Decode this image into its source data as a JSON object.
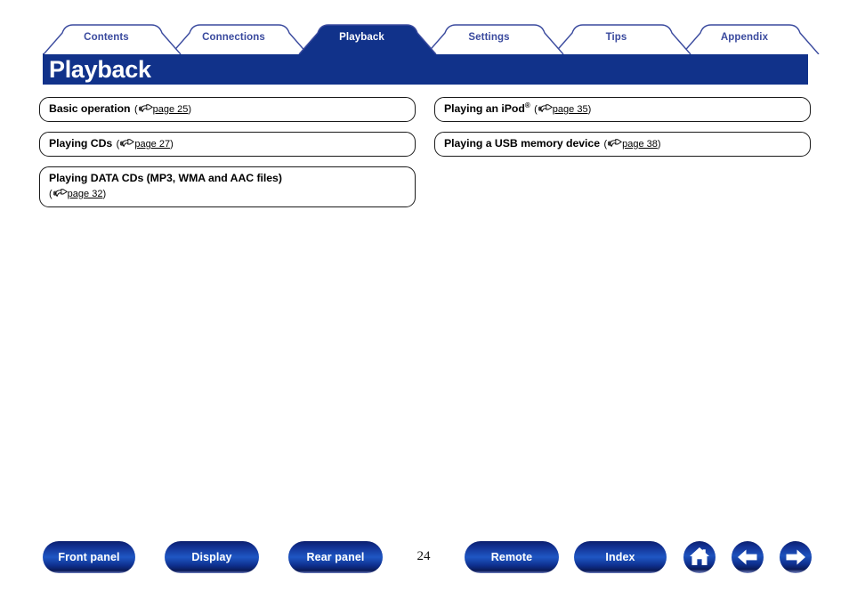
{
  "document": {
    "page_number": "24",
    "page_title": "Playback"
  },
  "tabs": [
    {
      "label": "Contents",
      "active": false
    },
    {
      "label": "Connections",
      "active": false
    },
    {
      "label": "Playback",
      "active": true
    },
    {
      "label": "Settings",
      "active": false
    },
    {
      "label": "Tips",
      "active": false
    },
    {
      "label": "Appendix",
      "active": false
    }
  ],
  "links": {
    "left": [
      {
        "title": "Basic operation",
        "ref_open": "(",
        "ref_icon": "pointing-hand-icon",
        "ref_page": "page 25",
        "ref_close": ")",
        "two_line": false
      },
      {
        "title": "Playing CDs",
        "ref_open": "(",
        "ref_icon": "pointing-hand-icon",
        "ref_page": "page 27",
        "ref_close": ")",
        "two_line": false
      },
      {
        "title": "Playing DATA CDs (MP3, WMA and AAC files)",
        "ref_open": "(",
        "ref_icon": "pointing-hand-icon",
        "ref_page": "page 32",
        "ref_close": ")",
        "two_line": true
      }
    ],
    "right": [
      {
        "title": "Playing an iPod",
        "title_sup": "®",
        "ref_open": "(",
        "ref_icon": "pointing-hand-icon",
        "ref_page": "page 35",
        "ref_close": ")",
        "two_line": false
      },
      {
        "title": "Playing a USB memory device",
        "ref_open": "(",
        "ref_icon": "pointing-hand-icon",
        "ref_page": "page 38",
        "ref_close": ")",
        "two_line": false
      }
    ]
  },
  "footer": {
    "buttons": [
      {
        "label": "Front panel"
      },
      {
        "label": "Display"
      },
      {
        "label": "Rear panel"
      },
      {
        "label": "Remote"
      },
      {
        "label": "Index"
      }
    ],
    "icons": [
      {
        "name": "home-icon"
      },
      {
        "name": "arrow-left-icon"
      },
      {
        "name": "arrow-right-icon"
      }
    ]
  },
  "colors": {
    "brand_navy": "#11328A",
    "tab_border": "#3A4A9E",
    "tab_text_inactive": "#3A4A9E",
    "tab_text_active": "#ffffff",
    "button_blue": "#1f57c4",
    "box_border": "#1a1a1a"
  }
}
